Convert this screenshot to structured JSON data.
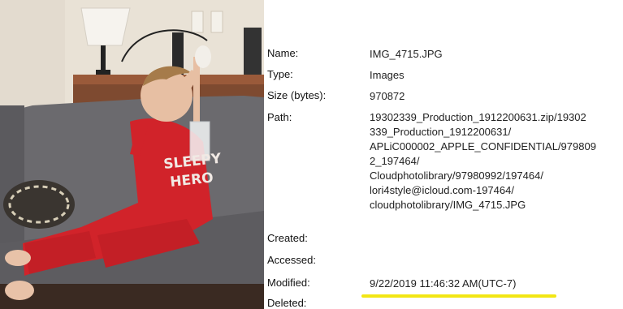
{
  "properties": {
    "name": {
      "label": "Name:",
      "value": "IMG_4715.JPG"
    },
    "type": {
      "label": "Type:",
      "value": "Images"
    },
    "size": {
      "label": "Size (bytes):",
      "value": "970872"
    },
    "path": {
      "label": "Path:",
      "lines": [
        "19302339_Production_1912200631.zip/19302",
        "339_Production_1912200631/",
        "APLiC000002_APPLE_CONFIDENTIAL/979809",
        "2_197464/",
        "Cloudphotolibrary/97980992/197464/",
        "lori4style@icloud.com-197464/",
        "cloudphotolibrary/IMG_4715.JPG"
      ]
    },
    "created": {
      "label": "Created:",
      "value": ""
    },
    "accessed": {
      "label": "Accessed:",
      "value": ""
    },
    "modified": {
      "label": "Modified:",
      "value": "9/22/2019 11:46:32 AM(UTC-7)"
    },
    "deleted": {
      "label": "Deleted:",
      "value": ""
    }
  },
  "photo": {
    "shirt_text_line1": "SLEEPY",
    "shirt_text_line2": "HERO"
  },
  "colors": {
    "highlight": "#f2e614",
    "pajama_red": "#d1232a",
    "couch_gray": "#6b6a6e",
    "wall": "#e9e2d6"
  }
}
